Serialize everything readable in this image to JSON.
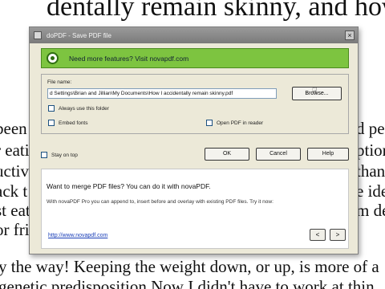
{
  "document": {
    "top_line": "dentally remain skinny, and how you c",
    "left_fragments": [
      "been",
      "r eati",
      "uctive",
      "ack t",
      "st eat",
      "or fri"
    ],
    "right_fragments": [
      "d peo",
      "ption",
      "than",
      "e ide",
      "m de"
    ],
    "bottom_line1": "y the way!  Keeping the weight down, or up, is more of a",
    "bottom_line2": "genetic predisposition  Now I didn't have to work at thin"
  },
  "dialog": {
    "title": "doPDF - Save PDF file",
    "close_glyph": "×",
    "promo_top": {
      "text": "Need more features? Visit novapdf.com"
    },
    "file_name_label": "File name:",
    "file_name_value": "d Settings\\Brian and Jillian\\My Documents\\How I accidentally remain skinny.pdf",
    "browse_label": "Browse...",
    "always_use_folder_label": "Always use this folder",
    "embed_fonts_label": "Embed fonts",
    "open_pdf_label": "Open PDF in reader",
    "stay_on_top_label": "Stay on top",
    "ok_label": "OK",
    "cancel_label": "Cancel",
    "help_label": "Help",
    "promo_bottom": {
      "heading": "Want to merge PDF files? You can do it with novaPDF.",
      "body": "With novaPDF Pro you can append to, insert before and overlay with existing PDF files. Try it now:",
      "link": "http://www.novapdf.com",
      "prev_glyph": "<",
      "next_glyph": ">"
    }
  },
  "colors": {
    "promo_green": "#7dc440",
    "dialog_bg": "#ece9d8",
    "link": "#1a3fb8"
  }
}
